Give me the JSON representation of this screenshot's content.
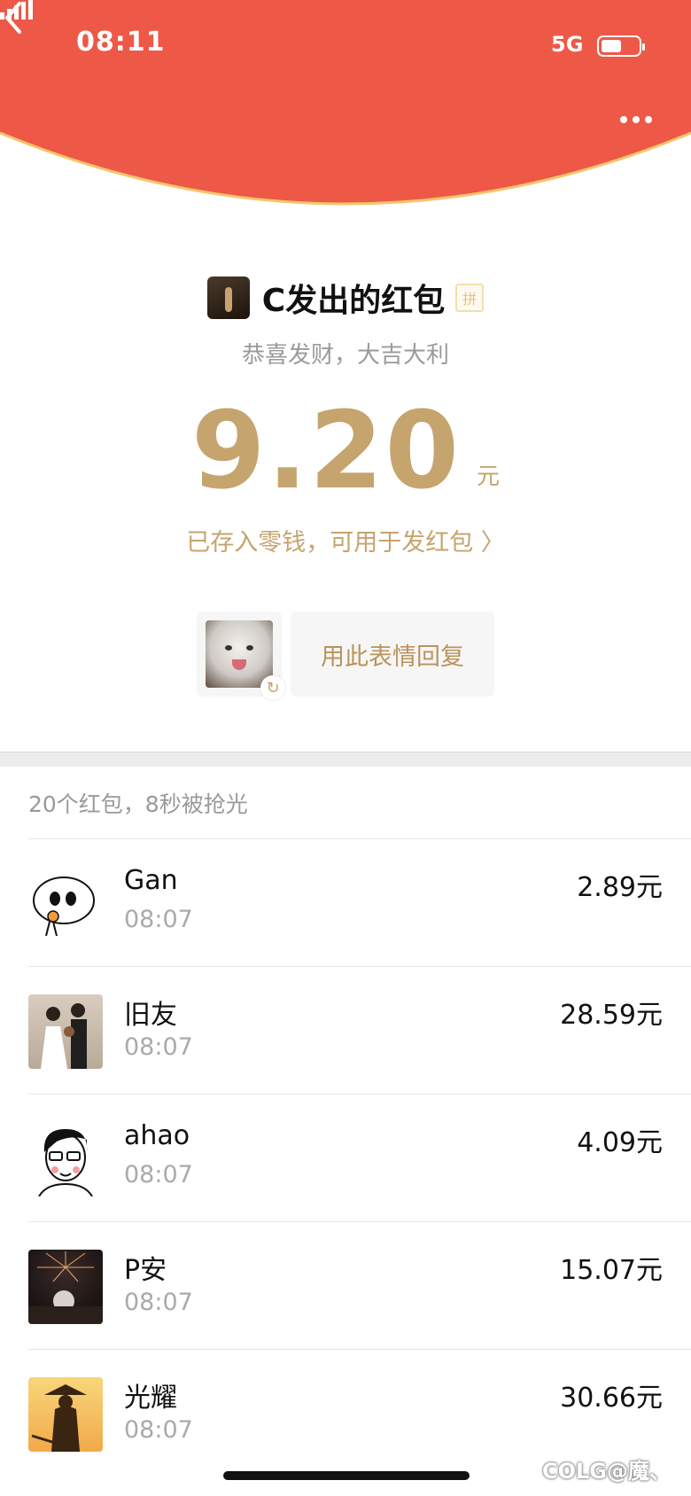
{
  "status_bar": {
    "time": "08:11",
    "network": "5G"
  },
  "colors": {
    "header_red": "#ee5847",
    "gold": "#c5a46e",
    "gold_border": "#f2c66d"
  },
  "header": {
    "back_icon": "chevron-left-icon",
    "more_icon": "more-dots-icon"
  },
  "packet": {
    "sender_title": "C发出的红包",
    "pin_badge": "拼",
    "greeting": "恭喜发财，大吉大利",
    "amount": "9.20",
    "unit": "元",
    "stored_text": "已存入零钱，可用于发红包 〉",
    "reply_button": "用此表情回复"
  },
  "summary": "20个红包，8秒被抢光",
  "recipients": [
    {
      "name": "Gan",
      "time": "08:07",
      "amount": "2.89元"
    },
    {
      "name": "旧友",
      "time": "08:07",
      "amount": "28.59元"
    },
    {
      "name": "ahao",
      "time": "08:07",
      "amount": "4.09元"
    },
    {
      "name": "P安",
      "time": "08:07",
      "amount": "15.07元"
    },
    {
      "name": "光耀",
      "time": "08:07",
      "amount": "30.66元"
    }
  ],
  "watermark": "COLG@魔、"
}
